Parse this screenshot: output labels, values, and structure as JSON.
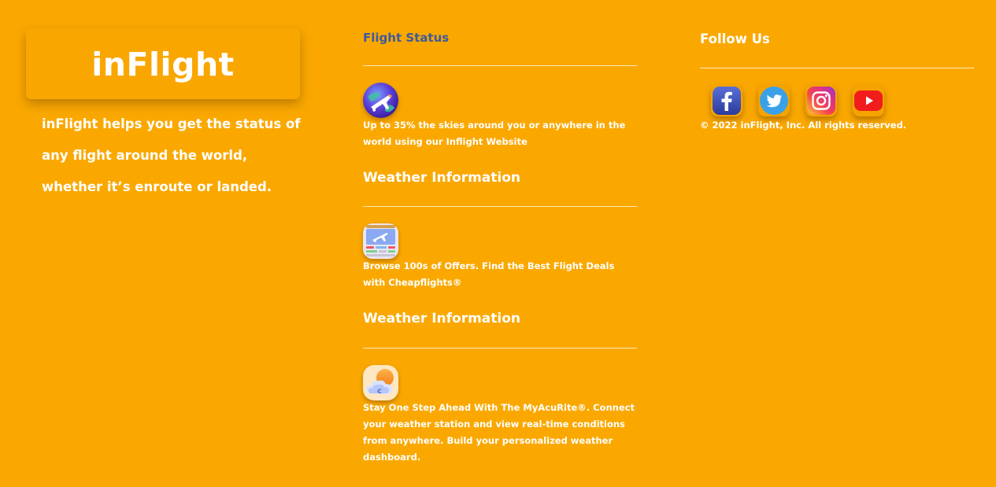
{
  "brand": {
    "logo": "inFlight",
    "tagline": "inFlight helps you get the status of any flight around the world, whether it’s enroute or landed."
  },
  "sections": {
    "flight_status": {
      "heading": "Flight Status",
      "icon": "airplane-globe-icon",
      "text": "Up to 35% the skies around you or anywhere in the world using our Inflight Website"
    },
    "weather_1": {
      "heading": "Weather Information",
      "icon": "flight-board-icon",
      "text": "Browse 100s of Offers. Find the Best Flight Deals with Cheapflights®"
    },
    "weather_2": {
      "heading": "Weather Information",
      "icon": "weather-cloud-icon",
      "text": "Stay One Step Ahead With The MyAcuRite®. Connect your weather station and view real-time conditions from anywhere. Build your personalized weather dashboard."
    }
  },
  "follow": {
    "heading": "Follow Us",
    "social": [
      {
        "name": "facebook-icon"
      },
      {
        "name": "twitter-icon"
      },
      {
        "name": "instagram-icon"
      },
      {
        "name": "youtube-icon"
      }
    ],
    "copyright": "© 2022 inFlight, Inc. All rights reserved."
  },
  "colors": {
    "background": "#faa800",
    "heading_accent": "#3f5a9c",
    "text": "#ffffff"
  }
}
